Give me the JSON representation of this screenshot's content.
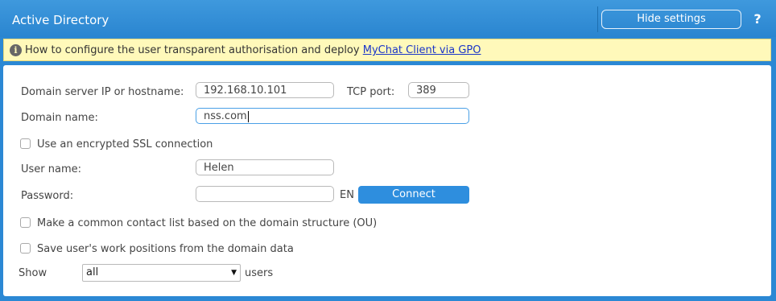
{
  "header": {
    "title": "Active Directory",
    "hide_settings": "Hide settings",
    "help": "?"
  },
  "info": {
    "text": "How to configure the user transparent authorisation and deploy",
    "link": "MyChat Client via GPO"
  },
  "form": {
    "server_label": "Domain server IP or hostname:",
    "server_value": "192.168.10.101",
    "port_label": "TCP port:",
    "port_value": "389",
    "domain_label": "Domain name:",
    "domain_value": "nss.com",
    "ssl_label": "Use an encrypted SSL connection",
    "ssl_checked": false,
    "user_label": "User name:",
    "user_value": "Helen",
    "password_label": "Password:",
    "password_value": "",
    "lang_indicator": "EN",
    "connect_label": "Connect",
    "ou_label": "Make a common contact list based on the domain structure (OU)",
    "ou_checked": false,
    "positions_label": "Save user's work positions from the domain data",
    "positions_checked": false,
    "show_label": "Show",
    "show_value": "all",
    "users_suffix": "users"
  },
  "colors": {
    "header_blue": "#2a85d0",
    "info_yellow": "#fff9ba",
    "link_blue": "#1a35c8",
    "button_blue": "#2e8ede"
  }
}
